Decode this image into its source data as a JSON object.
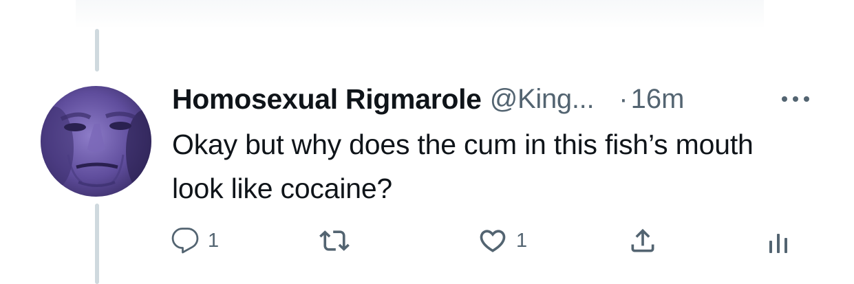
{
  "tweet": {
    "author": {
      "display_name": "Homosexual Rigmarole",
      "handle": "@King...",
      "avatar_alt": "avatar"
    },
    "separator": "·",
    "time": "16m",
    "text": "Okay but why does the cum in this fish’s mouth look like cocaine?",
    "actions": {
      "reply": {
        "icon": "reply-icon",
        "count": "1"
      },
      "retweet": {
        "icon": "retweet-icon",
        "count": ""
      },
      "like": {
        "icon": "heart-icon",
        "count": "1"
      },
      "share": {
        "icon": "share-icon"
      },
      "analytics": {
        "icon": "analytics-icon"
      }
    },
    "more": {
      "icon": "more-icon"
    }
  },
  "colors": {
    "text_primary": "#0f1419",
    "text_secondary": "#536471",
    "thread_line": "#cfd9de",
    "avatar_primary": "#6a57a4"
  }
}
